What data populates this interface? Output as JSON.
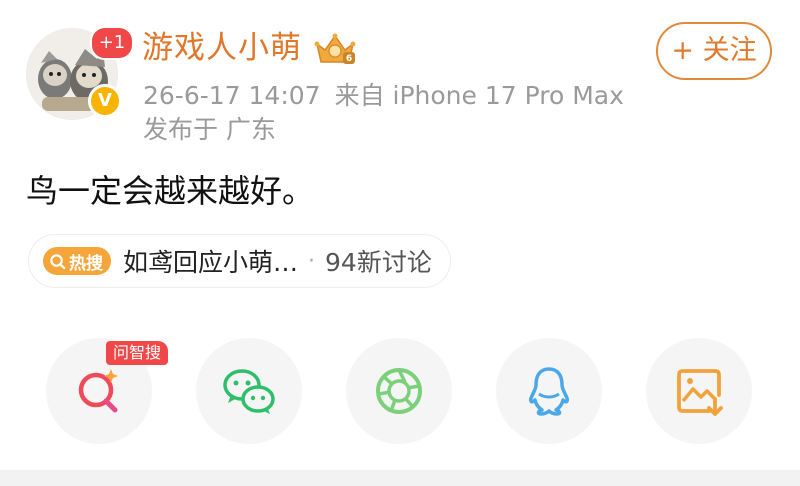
{
  "user": {
    "name": "游戏人小萌",
    "follower_badge": "+1",
    "verify_mark": "V"
  },
  "follow_button": {
    "label": "+ 关注"
  },
  "meta": {
    "time": "26-6-17 14:07",
    "source": "来自 iPhone 17 Pro Max",
    "location": "发布于 广东"
  },
  "post": {
    "text": "鸟一定会越来越好。"
  },
  "hot": {
    "tag": "热搜",
    "title": "如鸢回应小萌…",
    "separator": "·",
    "count": "94新讨论"
  },
  "share": {
    "ai_label": "问智搜",
    "icons": [
      "ai-search-icon",
      "wechat-icon",
      "moments-icon",
      "qq-icon",
      "save-image-icon"
    ]
  },
  "colors": {
    "accent": "#e0772a",
    "hot_tag": "#f6a53a",
    "badge_red": "#f04848",
    "wechat": "#2fbf6a",
    "moments": "#7bd07a",
    "qq": "#4aa8e8",
    "save": "#f2a23c"
  }
}
